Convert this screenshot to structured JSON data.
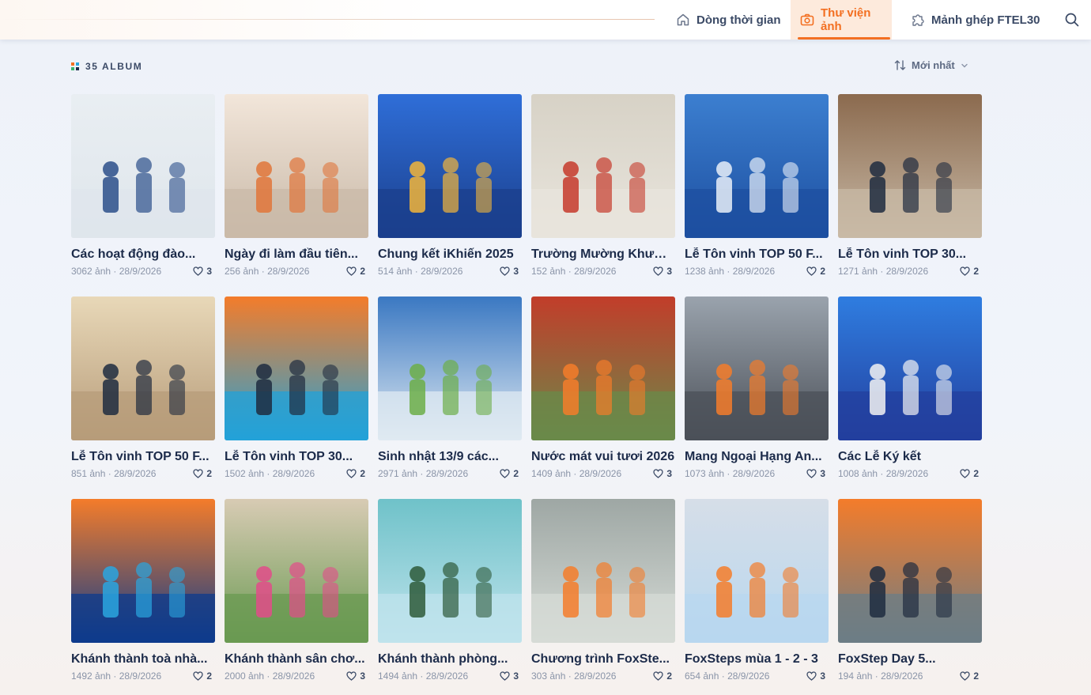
{
  "nav": {
    "timeline": "Dòng thời gian",
    "gallery": "Thư viện ảnh",
    "puzzle": "Mảnh ghép FTEL30"
  },
  "album_count": "35 ALBUM",
  "sort_label": "Mới nhất",
  "colors": {
    "accent": "#f36f21",
    "navy": "#1c2b4a",
    "muted": "#8a94a8"
  },
  "albums": [
    {
      "title": "Các hoạt động đào...",
      "count": "3062 ảnh",
      "date": "28/9/2026",
      "likes": "3"
    },
    {
      "title": "Ngày đi làm đầu tiên...",
      "count": "256 ảnh",
      "date": "28/9/2026",
      "likes": "2"
    },
    {
      "title": "Chung kết iKhiến 2025",
      "count": "514 ảnh",
      "date": "28/9/2026",
      "likes": "3"
    },
    {
      "title": "Trường Mường Khươn...",
      "count": "152 ảnh",
      "date": "28/9/2026",
      "likes": "3"
    },
    {
      "title": "Lễ Tôn vinh TOP 50 F...",
      "count": "1238 ảnh",
      "date": "28/9/2026",
      "likes": "2"
    },
    {
      "title": "Lễ Tôn vinh TOP 30...",
      "count": "1271 ảnh",
      "date": "28/9/2026",
      "likes": "2"
    },
    {
      "title": "Lễ Tôn vinh TOP 50 F...",
      "count": "851 ảnh",
      "date": "28/9/2026",
      "likes": "2"
    },
    {
      "title": "Lễ Tôn vinh TOP 30...",
      "count": "1502 ảnh",
      "date": "28/9/2026",
      "likes": "2"
    },
    {
      "title": "Sinh nhật 13/9 các...",
      "count": "2971 ảnh",
      "date": "28/9/2026",
      "likes": "2"
    },
    {
      "title": "Nước mát vui tươi 2026",
      "count": "1409 ảnh",
      "date": "28/9/2026",
      "likes": "3"
    },
    {
      "title": "Mang Ngoại Hạng An...",
      "count": "1073 ảnh",
      "date": "28/9/2026",
      "likes": "3"
    },
    {
      "title": "Các Lễ Ký kết",
      "count": "1008 ảnh",
      "date": "28/9/2026",
      "likes": "2"
    },
    {
      "title": "Khánh thành toà nhà...",
      "count": "1492 ảnh",
      "date": "28/9/2026",
      "likes": "2"
    },
    {
      "title": "Khánh thành sân chơ...",
      "count": "2000 ảnh",
      "date": "28/9/2026",
      "likes": "3"
    },
    {
      "title": "Khánh thành phòng...",
      "count": "1494 ảnh",
      "date": "28/9/2026",
      "likes": "3"
    },
    {
      "title": "Chương trình FoxSte...",
      "count": "303 ảnh",
      "date": "28/9/2026",
      "likes": "2"
    },
    {
      "title": "FoxSteps mùa 1 - 2 - 3",
      "count": "654 ảnh",
      "date": "28/9/2026",
      "likes": "3"
    },
    {
      "title": "FoxStep Day 5...",
      "count": "194 ảnh",
      "date": "28/9/2026",
      "likes": "2"
    }
  ]
}
